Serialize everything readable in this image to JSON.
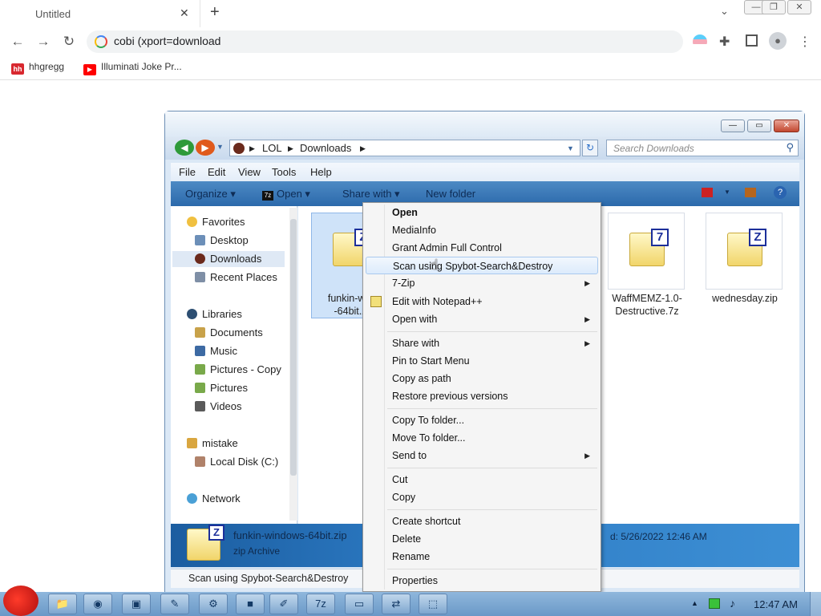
{
  "browser": {
    "tab_title": "Untitled",
    "url": "cobi (xport=download",
    "bookmarks": [
      {
        "label": "hhgregg",
        "icon": "hh",
        "color": "#d8282f"
      },
      {
        "label": "Illuminati Joke Pr...",
        "icon": "youtube",
        "color": "#ff0000"
      }
    ]
  },
  "explorer": {
    "breadcrumb": [
      "LOL",
      "Downloads"
    ],
    "search_placeholder": "Search Downloads",
    "menus": [
      "File",
      "Edit",
      "View",
      "Tools",
      "Help"
    ],
    "commands": [
      "Organize",
      "Open",
      "Share with",
      "New folder"
    ],
    "nav": {
      "favorites_label": "Favorites",
      "favorites": [
        "Desktop",
        "Downloads",
        "Recent Places"
      ],
      "libraries_label": "Libraries",
      "libraries": [
        "Documents",
        "Music",
        "Pictures - Copy",
        "Pictures",
        "Videos"
      ],
      "computer_label": "mistake",
      "computer": [
        "Local Disk (C:)"
      ],
      "network_label": "Network",
      "selected": "Downloads"
    },
    "files": [
      {
        "name_line1": "funkin-win",
        "name_line2": "-64bit.z",
        "icon_letter": "Z",
        "selected": true
      },
      {
        "name_line1": "WaffMEMZ-1.0-",
        "name_line2": "Destructive.7z",
        "icon_letter": "7",
        "selected": false
      },
      {
        "name_line1": "wednesday.zip",
        "name_line2": "",
        "icon_letter": "Z",
        "selected": false
      }
    ],
    "details": {
      "file_name": "funkin-windows-64bit.zip",
      "file_type": "zip Archive",
      "date_modified": "d: 5/26/2022 12:46 AM"
    },
    "status_text": "Scan using Spybot-Search&Destroy"
  },
  "context_menu": {
    "groups": [
      [
        {
          "label": "Open",
          "bold": true
        },
        {
          "label": "MediaInfo"
        },
        {
          "label": "Grant Admin Full Control"
        },
        {
          "label": "Scan using Spybot-Search&Destroy",
          "highlighted": true
        },
        {
          "label": "7-Zip",
          "submenu": true
        },
        {
          "label": "Edit with Notepad++",
          "icon": "notepad-icon"
        },
        {
          "label": "Open with",
          "submenu": true
        }
      ],
      [
        {
          "label": "Share with",
          "submenu": true
        },
        {
          "label": "Pin to Start Menu"
        },
        {
          "label": "Copy as path"
        },
        {
          "label": "Restore previous versions"
        }
      ],
      [
        {
          "label": "Copy To folder..."
        },
        {
          "label": "Move To folder..."
        },
        {
          "label": "Send to",
          "submenu": true
        }
      ],
      [
        {
          "label": "Cut"
        },
        {
          "label": "Copy"
        }
      ],
      [
        {
          "label": "Create shortcut"
        },
        {
          "label": "Delete"
        },
        {
          "label": "Rename"
        }
      ],
      [
        {
          "label": "Properties"
        }
      ]
    ]
  },
  "taskbar": {
    "clock": "12:47 AM",
    "apps": [
      "start-orb",
      "explorer",
      "chrome",
      "terminal",
      "paint",
      "tool",
      "app",
      "brush",
      "7zip",
      "window",
      "network",
      "installer"
    ]
  }
}
